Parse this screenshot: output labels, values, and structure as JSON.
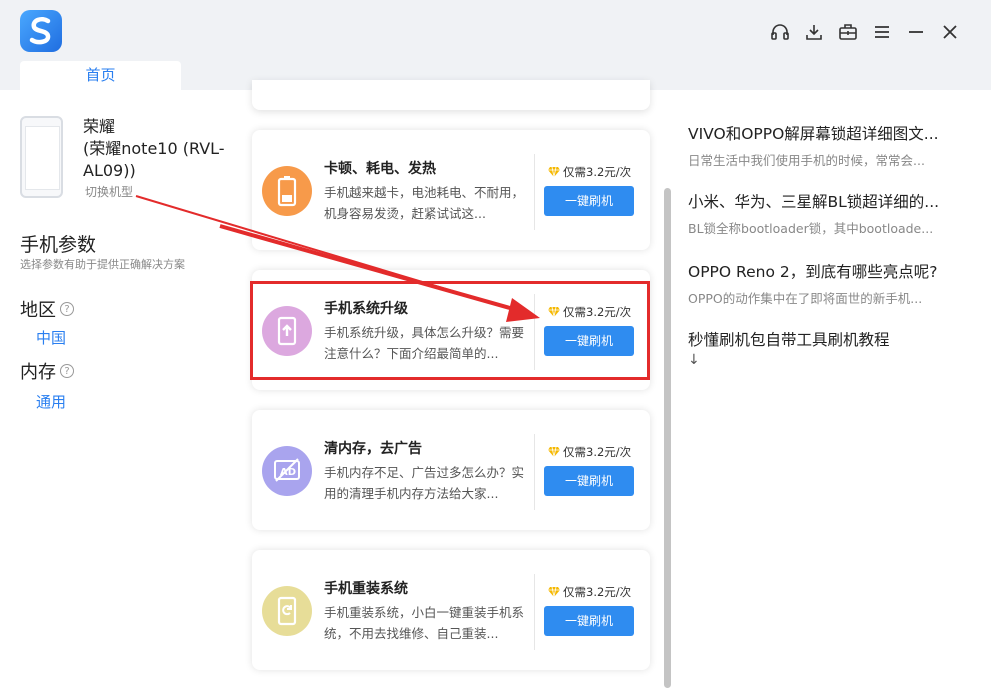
{
  "window": {
    "tab_home": "首页",
    "icons": [
      "headset-icon",
      "download-icon",
      "toolbox-icon",
      "menu-icon",
      "minimize-icon",
      "close-icon"
    ]
  },
  "device": {
    "brand": "荣耀",
    "model": "(荣耀note10 (RVL-AL09))",
    "switch_label": "切换机型"
  },
  "params": {
    "title": "手机参数",
    "subtitle": "选择参数有助于提供正确解决方案",
    "region_label": "地区",
    "region_value": "中国",
    "memory_label": "内存",
    "memory_value": "通用"
  },
  "cards": [
    {
      "title": "卡顿、耗电、发热",
      "desc": "手机越来越卡，电池耗电、不耐用，机身容易发烫，赶紧试试这...",
      "price": "仅需3.2元/次",
      "button": "一键刷机",
      "icon": "battery-icon",
      "icon_color": "#f79a4a"
    },
    {
      "title": "手机系统升级",
      "desc": "手机系统升级，具体怎么升级？需要注意什么？下面介绍最简单的...",
      "price": "仅需3.2元/次",
      "button": "一键刷机",
      "icon": "upgrade-icon",
      "icon_color": "#dca8df"
    },
    {
      "title": "清内存，去广告",
      "desc": "手机内存不足、广告过多怎么办？实用的清理手机内存方法给大家...",
      "price": "仅需3.2元/次",
      "button": "一键刷机",
      "icon": "ad-block-icon",
      "icon_color": "#a9a4ee"
    },
    {
      "title": "手机重装系统",
      "desc": "手机重装系统，小白一键重装手机系统，不用去找维修、自己重装...",
      "price": "仅需3.2元/次",
      "button": "一键刷机",
      "icon": "reinstall-icon",
      "icon_color": "#e7dd98"
    }
  ],
  "articles": [
    {
      "title": "VIVO和OPPO解屏幕锁超详细图文...",
      "desc": "日常生活中我们使用手机的时候，常常会..."
    },
    {
      "title": "小米、华为、三星解BL锁超详细的...",
      "desc": "BL锁全称bootloader锁，其中bootloade..."
    },
    {
      "title": "OPPO Reno 2，到底有哪些亮点呢?",
      "desc": "OPPO的动作集中在了即将面世的新手机..."
    },
    {
      "title": "秒懂刷机包自带工具刷机教程",
      "arrow": "↓"
    }
  ],
  "colors": {
    "accent": "#2a7ff0",
    "button": "#2f8cf0",
    "highlight": "#e32b2b",
    "diamond": "#f5b800"
  }
}
